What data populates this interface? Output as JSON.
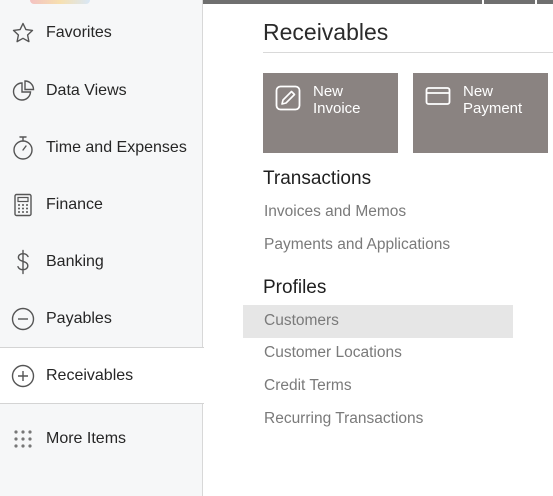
{
  "sidebar": {
    "items": [
      {
        "label": "Favorites",
        "icon": "star-icon"
      },
      {
        "label": "Data Views",
        "icon": "pie-chart-icon"
      },
      {
        "label": "Time and Expenses",
        "icon": "stopwatch-icon"
      },
      {
        "label": "Finance",
        "icon": "calculator-icon"
      },
      {
        "label": "Banking",
        "icon": "dollar-icon"
      },
      {
        "label": "Payables",
        "icon": "minus-circle-icon"
      },
      {
        "label": "Receivables",
        "icon": "plus-circle-icon",
        "active": true
      },
      {
        "label": "More Items",
        "icon": "dots-grid-icon"
      }
    ]
  },
  "main": {
    "title": "Receivables",
    "tiles": [
      {
        "label_line1": "New",
        "label_line2": "Invoice",
        "icon": "edit-icon"
      },
      {
        "label_line1": "New",
        "label_line2": "Payment",
        "icon": "credit-card-icon"
      }
    ],
    "sections": [
      {
        "title": "Transactions",
        "links": [
          "Invoices and Memos",
          "Payments and Applications"
        ]
      },
      {
        "title": "Profiles",
        "links": [
          "Customers",
          "Customer Locations",
          "Credit Terms",
          "Recurring Transactions"
        ]
      }
    ],
    "highlighted_link": "Customers"
  },
  "colors": {
    "tile_bg": "#8a8381",
    "sidebar_bg": "#f6f7f8",
    "link_color": "#7a7a7a",
    "highlight_bg": "#e6e6e6"
  }
}
